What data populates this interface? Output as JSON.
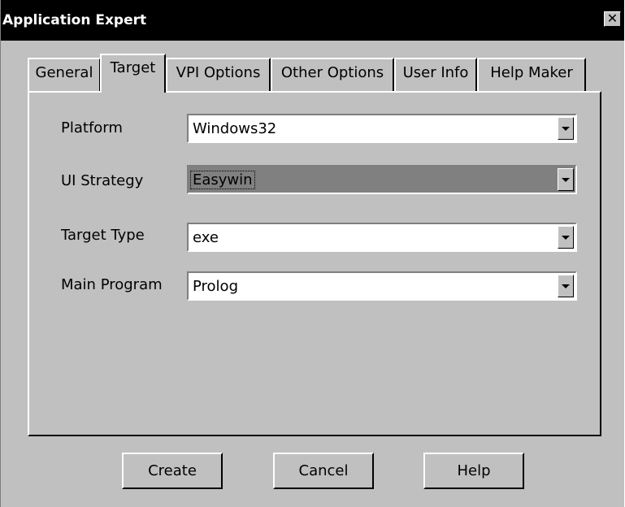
{
  "window": {
    "title": "Application Expert",
    "close_glyph": "✕"
  },
  "tabs": [
    {
      "label": "General",
      "active": false
    },
    {
      "label": "Target",
      "active": true
    },
    {
      "label": "VPI Options",
      "active": false
    },
    {
      "label": "Other Options",
      "active": false
    },
    {
      "label": "User Info",
      "active": false
    },
    {
      "label": "Help Maker",
      "active": false
    }
  ],
  "fields": [
    {
      "label": "Platform",
      "value": "Windows32",
      "selected": false
    },
    {
      "label": "UI Strategy",
      "value": "Easywin",
      "selected": true
    },
    {
      "label": "Target Type",
      "value": "exe",
      "selected": false
    },
    {
      "label": "Main Program",
      "value": "Prolog",
      "selected": false
    }
  ],
  "buttons": {
    "create": "Create",
    "cancel": "Cancel",
    "help": "Help"
  },
  "colors": {
    "face": "#c0c0c0",
    "title_bar": "#000000",
    "selection": "#808080"
  },
  "icons": {
    "close": "close-icon",
    "dropdown": "chevron-down-icon"
  }
}
